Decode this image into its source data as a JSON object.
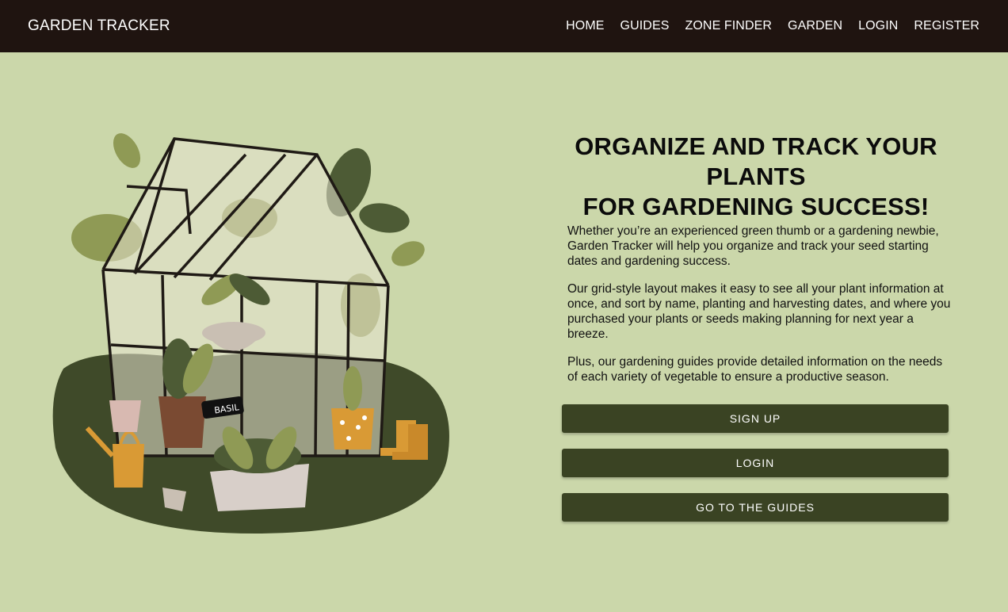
{
  "nav": {
    "brand": "GARDEN TRACKER",
    "links": [
      "HOME",
      "GUIDES",
      "ZONE FINDER",
      "GARDEN",
      "LOGIN",
      "REGISTER"
    ]
  },
  "hero": {
    "headline_line1": "ORGANIZE AND TRACK YOUR PLANTS",
    "headline_line2": "FOR GARDENING SUCCESS!",
    "paragraphs": [
      "Whether you’re an experienced green thumb or a gardening newbie, Garden Tracker will help you organize and track your seed starting dates and gardening success.",
      "Our grid-style layout makes it easy to see all your plant information at once, and sort by name, planting and harvesting dates, and where you purchased your plants or seeds making planning for next year a breeze.",
      "Plus, our gardening guides provide detailed information on the needs of each variety of vegetable to ensure a productive season."
    ],
    "buttons": {
      "signup": "SIGN UP",
      "login": "LOGIN",
      "guides": "GO TO THE GUIDES"
    },
    "illustration_label": "BASIL"
  },
  "colors": {
    "navbar": "#1f1410",
    "background": "#cbd7aa",
    "button": "#3a4323",
    "ground": "#3f4a29",
    "foliage_dark": "#4d5b35",
    "foliage_light": "#8f9a55",
    "accent_orange": "#d99a35",
    "pot_terracotta": "#7a4a32"
  }
}
